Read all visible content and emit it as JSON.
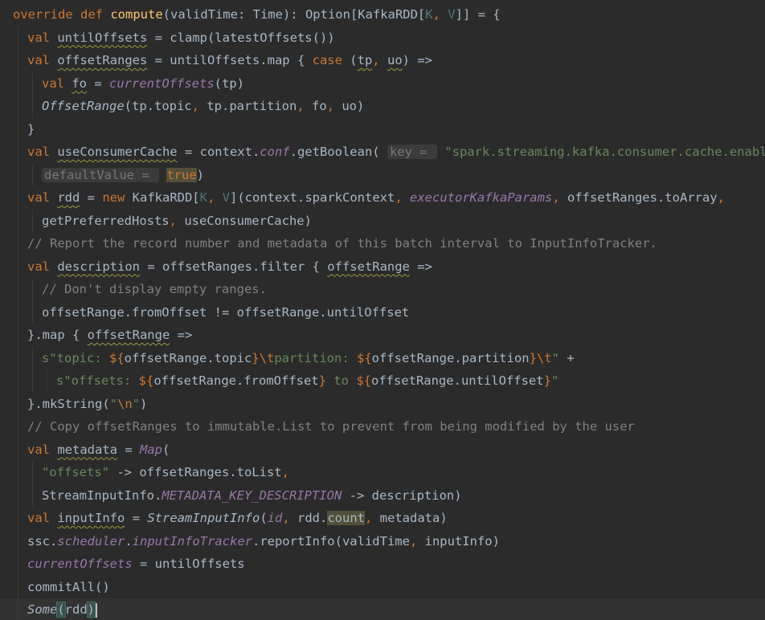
{
  "editor": {
    "lines": [
      {
        "indent": 0,
        "tokens": [
          {
            "t": "override def ",
            "c": "kw"
          },
          {
            "t": "compute",
            "c": "fn"
          },
          {
            "t": "(validTime: Time): Option[KafkaRDD[",
            "c": "pl"
          },
          {
            "t": "K",
            "c": "tp"
          },
          {
            "t": ", ",
            "c": "kw"
          },
          {
            "t": "V",
            "c": "tp"
          },
          {
            "t": "]] = {",
            "c": "pl"
          }
        ]
      },
      {
        "indent": 1,
        "tokens": [
          {
            "t": "val ",
            "c": "kw"
          },
          {
            "t": "untilOffsets",
            "c": "pl sq"
          },
          {
            "t": " = clamp(latestOffsets())",
            "c": "pl"
          }
        ]
      },
      {
        "indent": 1,
        "tokens": [
          {
            "t": "val ",
            "c": "kw"
          },
          {
            "t": "offsetRanges",
            "c": "pl sq"
          },
          {
            "t": " = untilOffsets.map { ",
            "c": "pl"
          },
          {
            "t": "case ",
            "c": "kw"
          },
          {
            "t": "(",
            "c": "pl"
          },
          {
            "t": "tp",
            "c": "pl sq"
          },
          {
            "t": ", ",
            "c": "kw"
          },
          {
            "t": "uo",
            "c": "pl sq"
          },
          {
            "t": ") =>",
            "c": "pl"
          }
        ]
      },
      {
        "indent": 2,
        "tokens": [
          {
            "t": "val ",
            "c": "kw"
          },
          {
            "t": "fo",
            "c": "pl sq"
          },
          {
            "t": " = ",
            "c": "pl"
          },
          {
            "t": "currentOffsets",
            "c": "pu"
          },
          {
            "t": "(tp)",
            "c": "pl"
          }
        ]
      },
      {
        "indent": 2,
        "tokens": [
          {
            "t": "OffsetRange",
            "c": "pl it"
          },
          {
            "t": "(tp.topic",
            "c": "pl"
          },
          {
            "t": ", ",
            "c": "kw"
          },
          {
            "t": "tp.partition",
            "c": "pl"
          },
          {
            "t": ", ",
            "c": "kw"
          },
          {
            "t": "fo",
            "c": "pl"
          },
          {
            "t": ", ",
            "c": "kw"
          },
          {
            "t": "uo)",
            "c": "pl"
          }
        ]
      },
      {
        "indent": 1,
        "tokens": [
          {
            "t": "}",
            "c": "pl"
          }
        ]
      },
      {
        "indent": 1,
        "tokens": [
          {
            "t": "val ",
            "c": "kw"
          },
          {
            "t": "useConsumerCache",
            "c": "pl sq"
          },
          {
            "t": " = context.",
            "c": "pl"
          },
          {
            "t": "conf",
            "c": "pu"
          },
          {
            "t": ".getBoolean( ",
            "c": "pl"
          },
          {
            "t": "key = ",
            "c": "hint"
          },
          {
            "t": " \"spark.streaming.kafka.consumer.cache.enabled\"",
            "c": "st"
          },
          {
            "t": ",",
            "c": "kw"
          }
        ]
      },
      {
        "indent": 2,
        "tokens": [
          {
            "t": "defaultValue = ",
            "c": "hint"
          },
          {
            "t": " ",
            "c": "pl"
          },
          {
            "t": "true",
            "c": "kw hl"
          },
          {
            "t": ")",
            "c": "pl"
          }
        ]
      },
      {
        "indent": 1,
        "tokens": [
          {
            "t": "val ",
            "c": "kw"
          },
          {
            "t": "rdd",
            "c": "pl sq"
          },
          {
            "t": " = ",
            "c": "pl"
          },
          {
            "t": "new ",
            "c": "kw"
          },
          {
            "t": "KafkaRDD[",
            "c": "pl"
          },
          {
            "t": "K",
            "c": "tp"
          },
          {
            "t": ", ",
            "c": "kw"
          },
          {
            "t": "V",
            "c": "tp"
          },
          {
            "t": "](context.sparkContext",
            "c": "pl"
          },
          {
            "t": ", ",
            "c": "kw"
          },
          {
            "t": "executorKafkaParams",
            "c": "pu"
          },
          {
            "t": ", ",
            "c": "kw"
          },
          {
            "t": "offsetRanges.toArray",
            "c": "pl"
          },
          {
            "t": ",",
            "c": "kw"
          }
        ]
      },
      {
        "indent": 2,
        "tokens": [
          {
            "t": "getPreferredHosts",
            "c": "pl"
          },
          {
            "t": ", ",
            "c": "kw"
          },
          {
            "t": "useConsumerCache)",
            "c": "pl"
          }
        ]
      },
      {
        "indent": 1,
        "tokens": [
          {
            "t": "// Report the record number and metadata of this batch interval to InputInfoTracker.",
            "c": "cm"
          }
        ]
      },
      {
        "indent": 1,
        "tokens": [
          {
            "t": "val ",
            "c": "kw"
          },
          {
            "t": "description",
            "c": "pl sq"
          },
          {
            "t": " = offsetRanges.filter { ",
            "c": "pl"
          },
          {
            "t": "offsetRange",
            "c": "pl sq"
          },
          {
            "t": " =>",
            "c": "pl"
          }
        ]
      },
      {
        "indent": 2,
        "tokens": [
          {
            "t": "// Don't display empty ranges.",
            "c": "cm"
          }
        ]
      },
      {
        "indent": 2,
        "tokens": [
          {
            "t": "offsetRange.fromOffset != offsetRange.untilOffset",
            "c": "pl"
          }
        ]
      },
      {
        "indent": 1,
        "tokens": [
          {
            "t": "}.map { ",
            "c": "pl"
          },
          {
            "t": "offsetRange",
            "c": "pl sq"
          },
          {
            "t": " =>",
            "c": "pl"
          }
        ]
      },
      {
        "indent": 2,
        "tokens": [
          {
            "t": "s\"topic: ",
            "c": "st"
          },
          {
            "t": "${",
            "c": "kw"
          },
          {
            "t": "offsetRange.topic",
            "c": "pl"
          },
          {
            "t": "}",
            "c": "kw"
          },
          {
            "t": "\\t",
            "c": "kw"
          },
          {
            "t": "partition: ",
            "c": "st"
          },
          {
            "t": "${",
            "c": "kw"
          },
          {
            "t": "offsetRange.partition",
            "c": "pl"
          },
          {
            "t": "}",
            "c": "kw"
          },
          {
            "t": "\\t",
            "c": "kw"
          },
          {
            "t": "\"",
            "c": "st"
          },
          {
            "t": " +",
            "c": "pl"
          }
        ]
      },
      {
        "indent": 3,
        "tokens": [
          {
            "t": "s\"offsets: ",
            "c": "st"
          },
          {
            "t": "${",
            "c": "kw"
          },
          {
            "t": "offsetRange.fromOffset",
            "c": "pl"
          },
          {
            "t": "}",
            "c": "kw"
          },
          {
            "t": " to ",
            "c": "st"
          },
          {
            "t": "${",
            "c": "kw"
          },
          {
            "t": "offsetRange.untilOffset",
            "c": "pl"
          },
          {
            "t": "}",
            "c": "kw"
          },
          {
            "t": "\"",
            "c": "st"
          }
        ]
      },
      {
        "indent": 1,
        "tokens": [
          {
            "t": "}.mkString(",
            "c": "pl"
          },
          {
            "t": "\"",
            "c": "st"
          },
          {
            "t": "\\n",
            "c": "kw"
          },
          {
            "t": "\"",
            "c": "st"
          },
          {
            "t": ")",
            "c": "pl"
          }
        ]
      },
      {
        "indent": 1,
        "tokens": [
          {
            "t": "// Copy offsetRanges to immutable.List to prevent from being modified by the user",
            "c": "cm"
          }
        ]
      },
      {
        "indent": 1,
        "tokens": [
          {
            "t": "val ",
            "c": "kw"
          },
          {
            "t": "metadata",
            "c": "pl sq"
          },
          {
            "t": " = ",
            "c": "pl"
          },
          {
            "t": "Map",
            "c": "pu"
          },
          {
            "t": "(",
            "c": "pl"
          }
        ]
      },
      {
        "indent": 2,
        "tokens": [
          {
            "t": "\"offsets\"",
            "c": "st"
          },
          {
            "t": " -> offsetRanges.toList",
            "c": "pl"
          },
          {
            "t": ",",
            "c": "kw"
          }
        ]
      },
      {
        "indent": 2,
        "tokens": [
          {
            "t": "StreamInputInfo.",
            "c": "pl"
          },
          {
            "t": "METADATA_KEY_DESCRIPTION",
            "c": "pu"
          },
          {
            "t": " -> description)",
            "c": "pl"
          }
        ]
      },
      {
        "indent": 1,
        "tokens": [
          {
            "t": "val ",
            "c": "kw"
          },
          {
            "t": "inputInfo",
            "c": "pl sq"
          },
          {
            "t": " = ",
            "c": "pl"
          },
          {
            "t": "StreamInputInfo",
            "c": "pl it"
          },
          {
            "t": "(",
            "c": "pl"
          },
          {
            "t": "id",
            "c": "pu"
          },
          {
            "t": ", ",
            "c": "kw"
          },
          {
            "t": "rdd.",
            "c": "pl"
          },
          {
            "t": "count",
            "c": "pl hl"
          },
          {
            "t": ", ",
            "c": "kw"
          },
          {
            "t": "metadata)",
            "c": "pl"
          }
        ]
      },
      {
        "indent": 1,
        "tokens": [
          {
            "t": "ssc.",
            "c": "pl"
          },
          {
            "t": "scheduler",
            "c": "pu"
          },
          {
            "t": ".",
            "c": "pl"
          },
          {
            "t": "inputInfoTracker",
            "c": "pu"
          },
          {
            "t": ".reportInfo(validTime",
            "c": "pl"
          },
          {
            "t": ", ",
            "c": "kw"
          },
          {
            "t": "inputInfo)",
            "c": "pl"
          }
        ]
      },
      {
        "indent": 1,
        "tokens": [
          {
            "t": "currentOffsets",
            "c": "pu"
          },
          {
            "t": " = untilOffsets",
            "c": "pl"
          }
        ]
      },
      {
        "indent": 1,
        "tokens": [
          {
            "t": "commitAll()",
            "c": "pl"
          }
        ]
      },
      {
        "indent": 1,
        "current": true,
        "tokens": [
          {
            "t": "Some",
            "c": "pl it"
          },
          {
            "t": "(",
            "c": "pl brace-hl"
          },
          {
            "t": "rdd",
            "c": "pl"
          },
          {
            "t": ")",
            "c": "pl brace-hl"
          },
          {
            "t": "",
            "c": "caret"
          }
        ]
      }
    ]
  }
}
